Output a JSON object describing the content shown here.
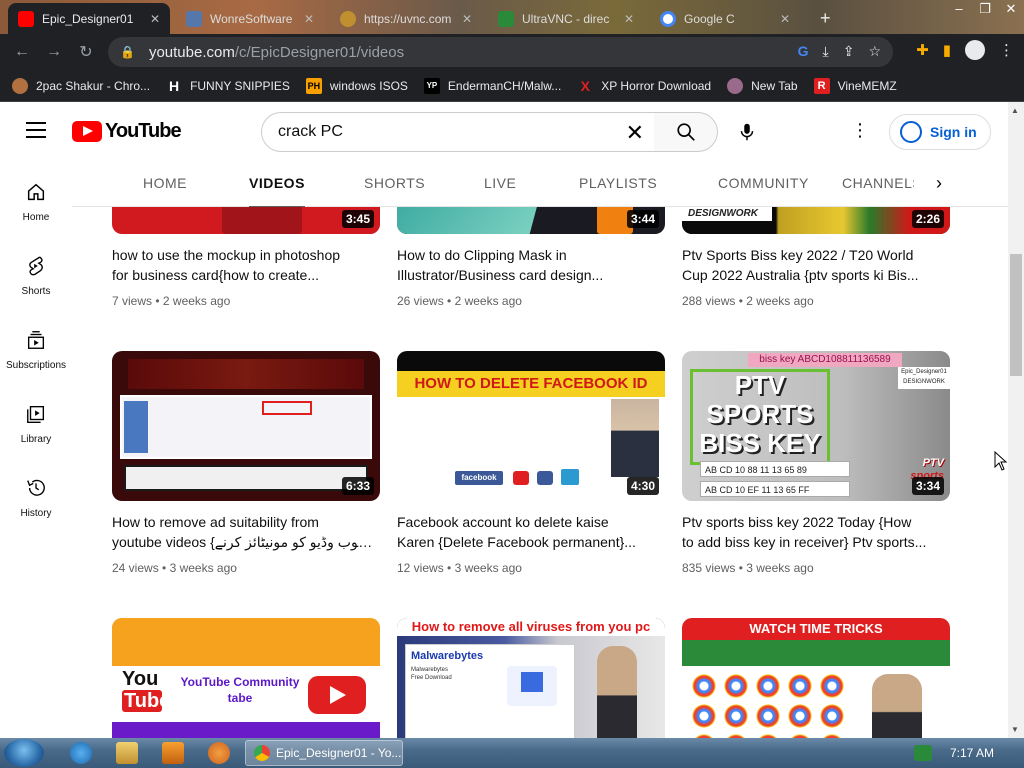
{
  "browser": {
    "tabs": [
      {
        "label": "Epic_Designer01",
        "active": true,
        "favicon_color": "#ff0000"
      },
      {
        "label": "WonreSoftware",
        "active": false,
        "favicon_color": "#5577aa"
      },
      {
        "label": "https://uvnc.com",
        "active": false,
        "favicon_color": "#c09030"
      },
      {
        "label": "UltraVNC - direc",
        "active": false,
        "favicon_color": "#2a8a3a"
      },
      {
        "label": "Google C",
        "active": false,
        "favicon_color": "#4285f4"
      }
    ],
    "url_host": "youtube.com",
    "url_path": "/c/EpicDesigner01/videos",
    "bookmarks": [
      {
        "label": "2pac Shakur - Chro...",
        "icon": "person-icon",
        "icon_text": "",
        "color": "#b07040"
      },
      {
        "label": "FUNNY SNIPPIES",
        "icon": "h-icon",
        "icon_text": "H",
        "color": "#ffffff"
      },
      {
        "label": "windows ISOS",
        "icon": "ph-icon",
        "icon_text": "PH",
        "color": "#f7a000"
      },
      {
        "label": "EndermanCH/Malw...",
        "icon": "yp-icon",
        "icon_text": "YP",
        "color": "#ffffff"
      },
      {
        "label": "XP Horror Download",
        "icon": "x-icon",
        "icon_text": "X",
        "color": "#e02020"
      },
      {
        "label": "New Tab",
        "icon": "globe-icon",
        "icon_text": "",
        "color": "#9a6a8a"
      },
      {
        "label": "VineMEMZ",
        "icon": "r-icon",
        "icon_text": "R",
        "color": "#e02020"
      }
    ]
  },
  "youtube": {
    "logo_text": "YouTube",
    "search_query": "crack PC",
    "sign_in": "Sign in",
    "channel_tabs": [
      {
        "label": "HOME",
        "active": false
      },
      {
        "label": "VIDEOS",
        "active": true
      },
      {
        "label": "SHORTS",
        "active": false
      },
      {
        "label": "LIVE",
        "active": false
      },
      {
        "label": "PLAYLISTS",
        "active": false
      },
      {
        "label": "COMMUNITY",
        "active": false
      },
      {
        "label": "CHANNELS",
        "active": false
      }
    ],
    "guide": [
      {
        "label": "Home",
        "icon": "home-icon"
      },
      {
        "label": "Shorts",
        "icon": "shorts-icon"
      },
      {
        "label": "Subscriptions",
        "icon": "subscriptions-icon"
      },
      {
        "label": "Library",
        "icon": "library-icon"
      },
      {
        "label": "History",
        "icon": "history-icon"
      }
    ],
    "videos": [
      {
        "title_line1": "how to use the mockup in photoshop",
        "title_line2": "for business card{how to create...",
        "views": "7 views",
        "age": "2 weeks ago",
        "duration": "3:45"
      },
      {
        "title_line1": "How to do Clipping Mask in",
        "title_line2": "Illustrator/Business card design...",
        "views": "26 views",
        "age": "2 weeks ago",
        "duration": "3:44"
      },
      {
        "title_line1": "Ptv Sports Biss key 2022 / T20 World",
        "title_line2": "Cup 2022 Australia {ptv sports ki Bis...",
        "views": "288 views",
        "age": "2 weeks ago",
        "duration": "2:26"
      },
      {
        "title_line1": "How to remove ad suitability from",
        "title_line2": "youtube videos {یوٹیوب وڈیو کو مونیٹائز کرنے...",
        "views": "24 views",
        "age": "3 weeks ago",
        "duration": "6:33"
      },
      {
        "title_line1": "Facebook account ko delete kaise",
        "title_line2": "Karen {Delete Facebook permanent}...",
        "views": "12 views",
        "age": "3 weeks ago",
        "duration": "4:30"
      },
      {
        "title_line1": "Ptv sports biss key 2022 Today {How",
        "title_line2": "to add biss key in receiver} Ptv sports...",
        "views": "835 views",
        "age": "3 weeks ago",
        "duration": "3:34"
      },
      {
        "title_line1": "",
        "title_line2": "",
        "views": "",
        "age": "",
        "duration": ""
      },
      {
        "title_line1": "",
        "title_line2": "",
        "views": "",
        "age": "",
        "duration": ""
      },
      {
        "title_line1": "",
        "title_line2": "",
        "views": "",
        "age": "",
        "duration": ""
      }
    ],
    "thumb_texts": {
      "t1_corner": "DESIGNWORK",
      "t4_banner": "HOW TO DELETE FACEBOOK ID",
      "t4_fb": "facebook",
      "t5_tag": "biss key ABCD108811136589",
      "t5_brand": "Epic_Designer01\nDESIGNWORK",
      "t5_main1": "PTV",
      "t5_main2": "SPORTS",
      "t5_main3": "BISS KEY",
      "t5_row1": "AB CD 10 88 11 13 65 89",
      "t5_row2": "AB CD 10 EF 11 13 65 FF",
      "t5_logo": "PTV",
      "t5_logo2": "sports",
      "t6_yt1": "You",
      "t6_yt2": "Tube",
      "t6_comm": "YouTube Community",
      "t6_tabe": "tabe",
      "t7_banner": "How to remove all viruses from you pc",
      "t7_mb": "Malwarebytes",
      "t7_mb2": "Malwarebytes\nFree Download",
      "t8_banner": "WATCH TIME TRICKS"
    }
  },
  "taskbar": {
    "task_label": "Epic_Designer01 - Yo...",
    "clock": "7:17 AM"
  }
}
